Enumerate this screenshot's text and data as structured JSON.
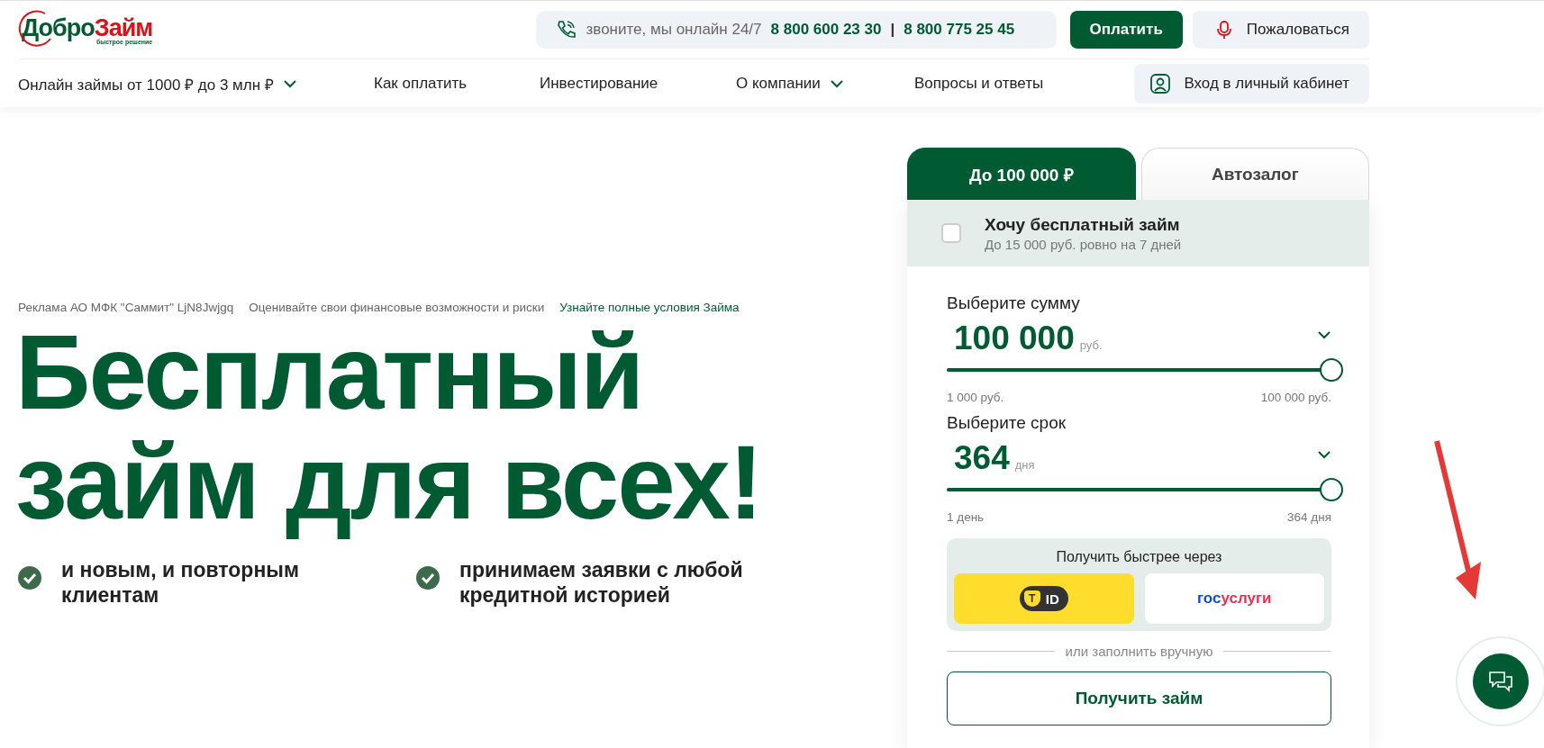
{
  "logo": {
    "name_parts": [
      "Добро",
      "Займ"
    ],
    "tagline": "быстрое решение"
  },
  "contact": {
    "label": "звоните, мы онлайн 24/7",
    "phones": [
      "8 800 600 23 30",
      "8 800 775 25 45"
    ],
    "separator": "|"
  },
  "header_buttons": [
    {
      "kind": "primary",
      "label": "Оплатить"
    },
    {
      "kind": "complaint",
      "label": "Пожаловаться"
    }
  ],
  "nav": [
    {
      "label": "Онлайн займы от 1000 ₽ до 3 млн ₽",
      "dropdown": true
    },
    {
      "label": "Как оплатить",
      "dropdown": false
    },
    {
      "label": "Инвестирование",
      "dropdown": false
    },
    {
      "label": "О компании",
      "dropdown": true
    },
    {
      "label": "Вопросы и ответы",
      "dropdown": false
    }
  ],
  "login_button": "Вход в личный кабинет",
  "hero": {
    "disclaimers": [
      {
        "text": "Реклама АО МФК \"Саммит\" LjN8Jwjgq",
        "kind": "note"
      },
      {
        "text": "Оценивайте свои финансовые возможности и риски",
        "kind": "note"
      },
      {
        "text": "Узнайте полные условия Займа",
        "kind": "link"
      }
    ],
    "title_lines": [
      "Бесплатный",
      "займ для всех!"
    ],
    "features": [
      "и новым, и повторным клиентам",
      "принимаем заявки с любой кредитной историей"
    ]
  },
  "calculator": {
    "tabs": [
      {
        "label": "До 100 000 ₽",
        "selected": true
      },
      {
        "label": "Автозалог",
        "selected": false
      }
    ],
    "free_loan": {
      "title": "Хочу бесплатный займ",
      "subtitle": "До 15 000 руб. ровно на 7 дней",
      "checked": false
    },
    "sliders": [
      {
        "label": "Выберите сумму",
        "value": "100 000",
        "unit": "руб.",
        "level": 1,
        "min": "1 000 руб.",
        "max": "100 000 руб."
      },
      {
        "label": "Выберите срок",
        "value": "364",
        "unit": "дня",
        "level": 1,
        "min": "1 день",
        "max": "364 дня"
      }
    ],
    "fast": {
      "title": "Получить быстрее через",
      "tid": {
        "badge": "T",
        "text": "ID"
      },
      "gosuslugi": [
        "гос",
        "услуги"
      ]
    },
    "divider_text": "или заполнить вручную",
    "submit": "Получить займ"
  }
}
